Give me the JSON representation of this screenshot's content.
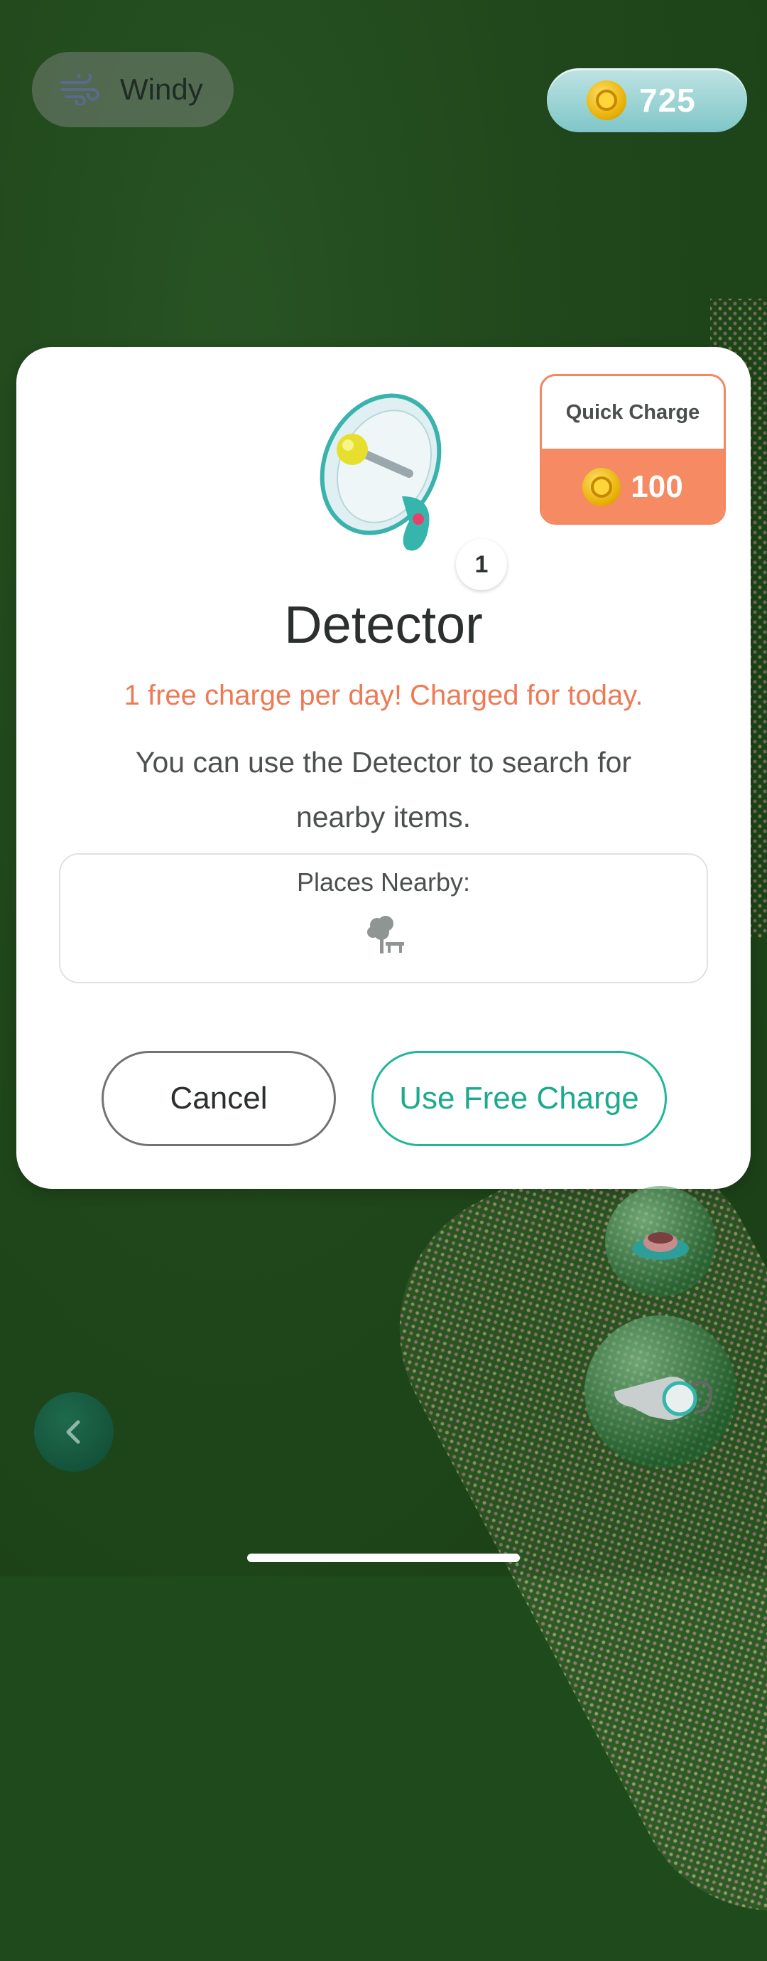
{
  "weather": {
    "label": "Windy",
    "icon": "wind-icon"
  },
  "currency": {
    "coins": "725",
    "icon": "coin-icon"
  },
  "dialog": {
    "quick_charge": {
      "label": "Quick Charge",
      "price": "100"
    },
    "item_count": "1",
    "title": "Detector",
    "free_note": "1 free charge per day! Charged for today.",
    "description": "You can use the Detector to search for nearby items.",
    "places_label": "Places Nearby:",
    "places_icon": "park-tree-bench-icon",
    "cancel_label": "Cancel",
    "use_label": "Use Free Charge"
  },
  "colors": {
    "accent_orange": "#f68a63",
    "accent_teal": "#1fb69a",
    "coin_gold": "#e6ad00"
  }
}
